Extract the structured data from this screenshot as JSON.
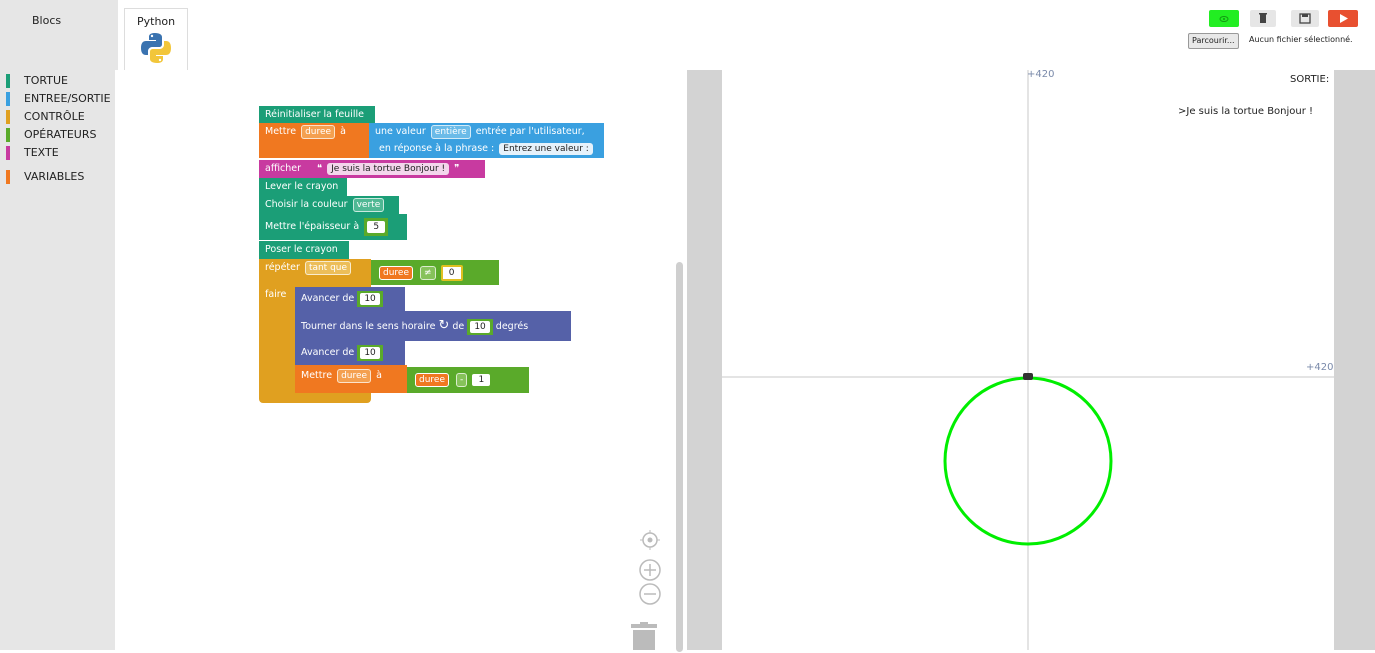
{
  "tabs": {
    "blocs": "Blocs",
    "python": "Python"
  },
  "categories": [
    {
      "label": "TORTUE",
      "color": "#1b9e77"
    },
    {
      "label": "ENTREE/SORTIE",
      "color": "#3aa0e0"
    },
    {
      "label": "CONTRÔLE",
      "color": "#e0a020"
    },
    {
      "label": "OPÉRATEURS",
      "color": "#5aaa2a"
    },
    {
      "label": "TEXTE",
      "color": "#c83aa0"
    },
    {
      "label": "VARIABLES",
      "color": "#f07820"
    }
  ],
  "blocks": {
    "reset": "Réinitialiser la feuille",
    "set_label": "Mettre",
    "set_var": "duree",
    "set_to": "à",
    "input_label": "une valeur",
    "input_type": "entière",
    "input_suffix": "entrée par l'utilisateur,",
    "input_prompt_label": "en réponse à la phrase :",
    "input_prompt": "Entrez une valeur :",
    "print_label": "afficher",
    "print_text": "Je suis la tortue Bonjour !",
    "pen_up": "Lever le crayon",
    "color_label": "Choisir la couleur",
    "color_value": "verte",
    "width_label": "Mettre l'épaisseur à",
    "width_value": "5",
    "pen_down": "Poser le crayon",
    "repeat_label": "répéter",
    "repeat_mode": "tant que",
    "cond_var": "duree",
    "cond_op": "≠",
    "cond_value": "0",
    "do_label": "faire",
    "forward_label": "Avancer de",
    "forward_value": "10",
    "turn_label": "Tourner dans le sens horaire",
    "turn_de": "de",
    "turn_value": "10",
    "turn_unit": "degrés",
    "forward2_value": "10",
    "set2_var": "duree",
    "minus_var": "duree",
    "minus_op": "-",
    "minus_value": "1"
  },
  "toolbar": {
    "file_button": "Parcourir...",
    "file_status": "Aucun fichier sélectionné."
  },
  "canvas": {
    "y_label": "+420",
    "x_label": "+420",
    "output_title": "SORTIE:",
    "output_text": ">Je suis la tortue Bonjour !",
    "circle_color": "#00ee00"
  }
}
